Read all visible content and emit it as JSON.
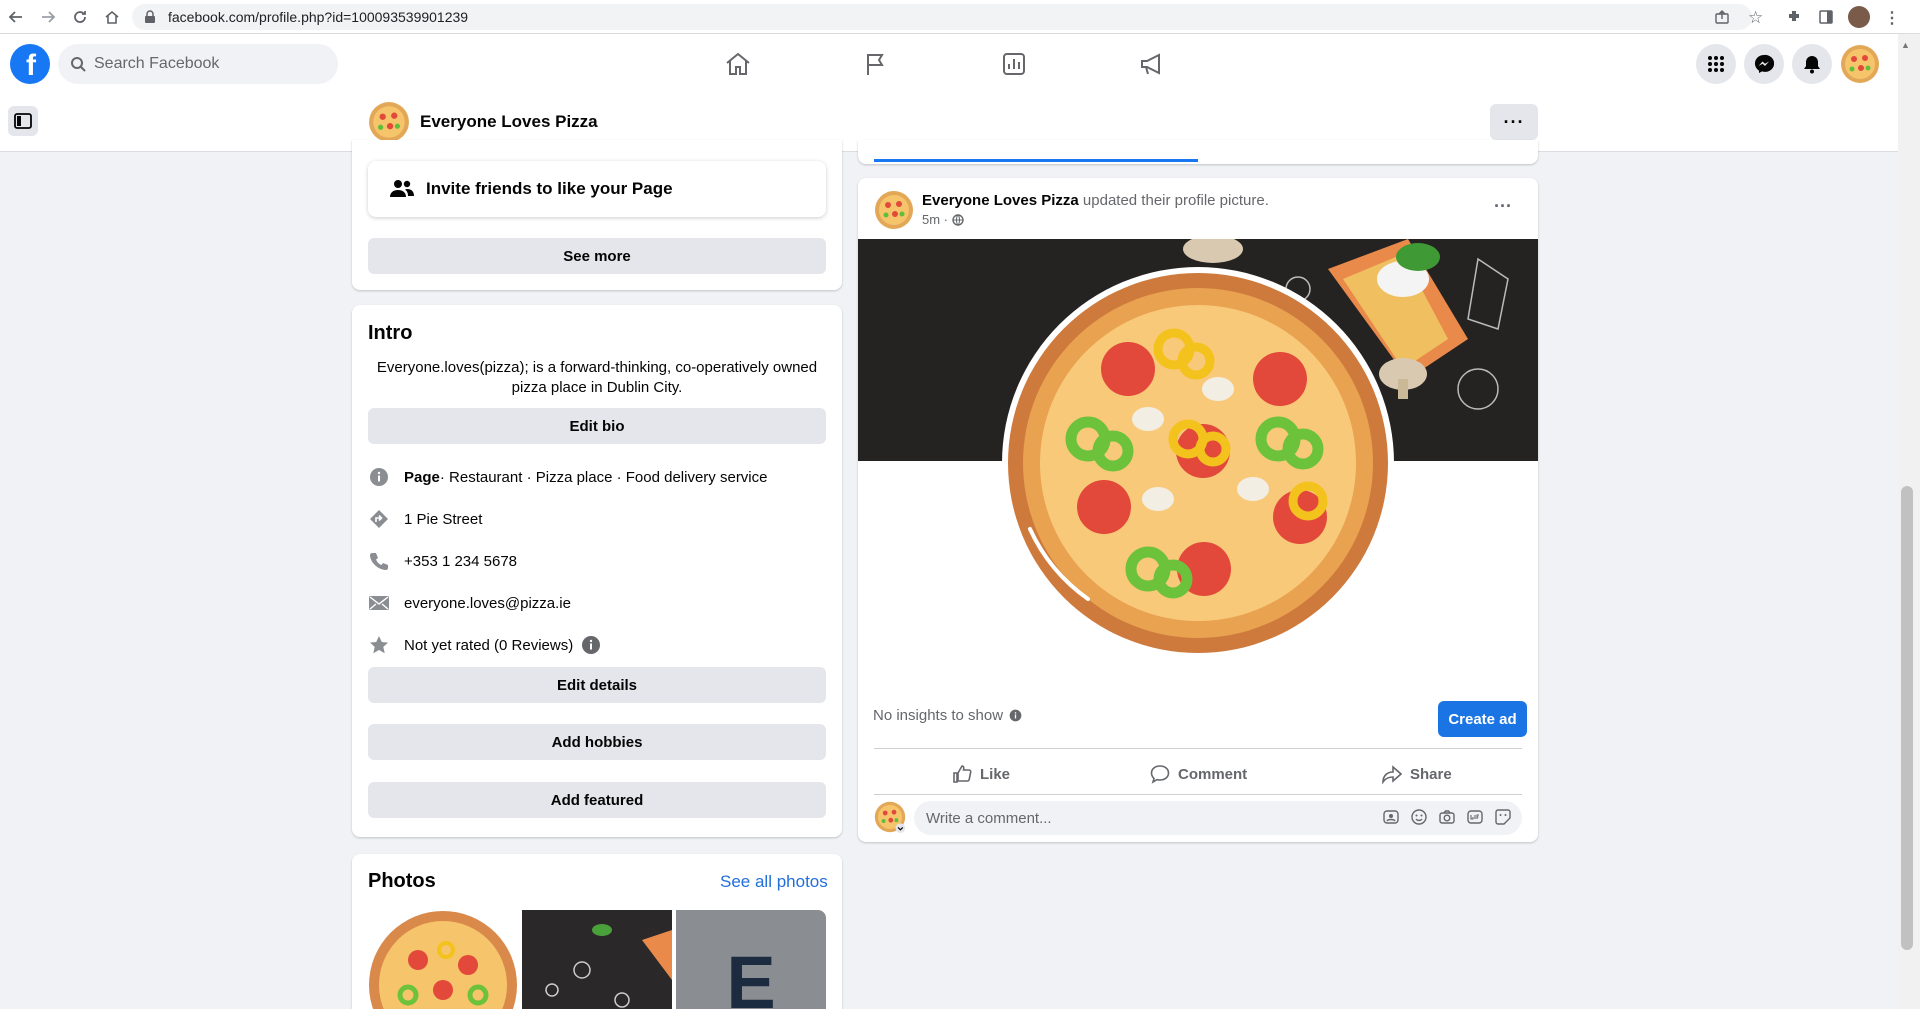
{
  "browser": {
    "url": "facebook.com/profile.php?id=100093539901239"
  },
  "topbar": {
    "logo_letter": "f",
    "search_placeholder": "Search Facebook"
  },
  "page_header": {
    "name": "Everyone Loves Pizza",
    "more_label": "···"
  },
  "left": {
    "invite_label": "Invite friends to like your Page",
    "see_more_label": "See more",
    "intro": {
      "title": "Intro",
      "bio": "Everyone.loves(pizza); is a forward-thinking, co-operatively owned pizza place in Dublin City.",
      "edit_bio_label": "Edit bio",
      "details": [
        {
          "icon": "info-icon",
          "bold": "Page",
          "text": " · Restaurant · Pizza place · Food delivery service"
        },
        {
          "icon": "address-icon",
          "bold": "",
          "text": "1 Pie Street"
        },
        {
          "icon": "phone-icon",
          "bold": "",
          "text": "+353 1 234 5678"
        },
        {
          "icon": "email-icon",
          "bold": "",
          "text": "everyone.loves@pizza.ie"
        },
        {
          "icon": "star-icon",
          "bold": "",
          "text": "Not yet rated (0 Reviews)"
        }
      ],
      "edit_details_label": "Edit details",
      "add_hobbies_label": "Add hobbies",
      "add_featured_label": "Add featured"
    },
    "photos": {
      "title": "Photos",
      "see_all_label": "See all photos",
      "thumb3_letter": "E"
    }
  },
  "post": {
    "author": "Everyone Loves Pizza",
    "action": " updated their profile picture.",
    "time": "5m ·",
    "menu_label": "···",
    "no_insights": "No insights to show",
    "create_ad_label": "Create ad",
    "like_label": "Like",
    "comment_label": "Comment",
    "share_label": "Share",
    "comment_placeholder": "Write a comment..."
  },
  "colors": {
    "brand": "#1877f2",
    "link": "#216fdb",
    "page_bg": "#f0f2f5"
  }
}
